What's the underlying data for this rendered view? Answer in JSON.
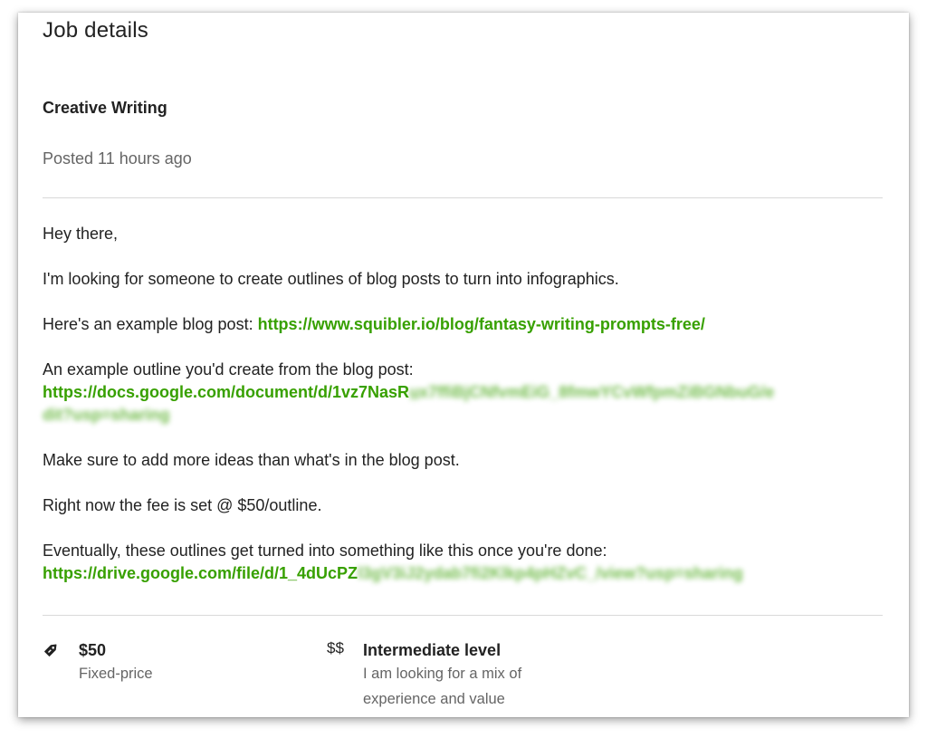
{
  "header": {
    "title": "Job details"
  },
  "job": {
    "title": "Creative Writing",
    "posted": "Posted 11 hours ago"
  },
  "description": {
    "greeting": "Hey there,",
    "intro": "I'm looking for someone to create outlines of blog posts to turn into infographics.",
    "example_prefix": "Here's an example blog post: ",
    "example_link": "https://www.squibler.io/blog/fantasy-writing-prompts-free/",
    "outline_prefix": "An example outline you'd create from the blog post:",
    "outline_link_visible": "https://docs.google.com/document/d/1vz7NasR",
    "outline_link_blurred_1": "u̲x7ffiBjCNfvmEiG_8fmwYCvWfpmZiBGNbuG/e",
    "outline_link_blurred_2": "dit?usp=sharing",
    "more_ideas": "Make sure to add more ideas than what's in the blog post.",
    "fee": "Right now the fee is set @ $50/outline.",
    "eventually": "Eventually, these outlines get turned into something like this once you're done:",
    "drive_link_visible": "https://drive.google.com/file/d/1_4dUcPZ",
    "drive_link_blurred": "l3gV3iJ2ydab7fi2Klkp4pHZvC_/view?usp=sharing"
  },
  "meta": {
    "price": {
      "icon": "tag-icon",
      "amount": "$50",
      "type": "Fixed-price"
    },
    "level": {
      "icon_text": "$$",
      "label": "Intermediate level",
      "desc_line1": "I am looking for a mix of",
      "desc_line2": "experience and value"
    }
  },
  "colors": {
    "link": "#37a000",
    "text": "#222222",
    "muted": "#656565",
    "divider": "#d9d9d9"
  }
}
